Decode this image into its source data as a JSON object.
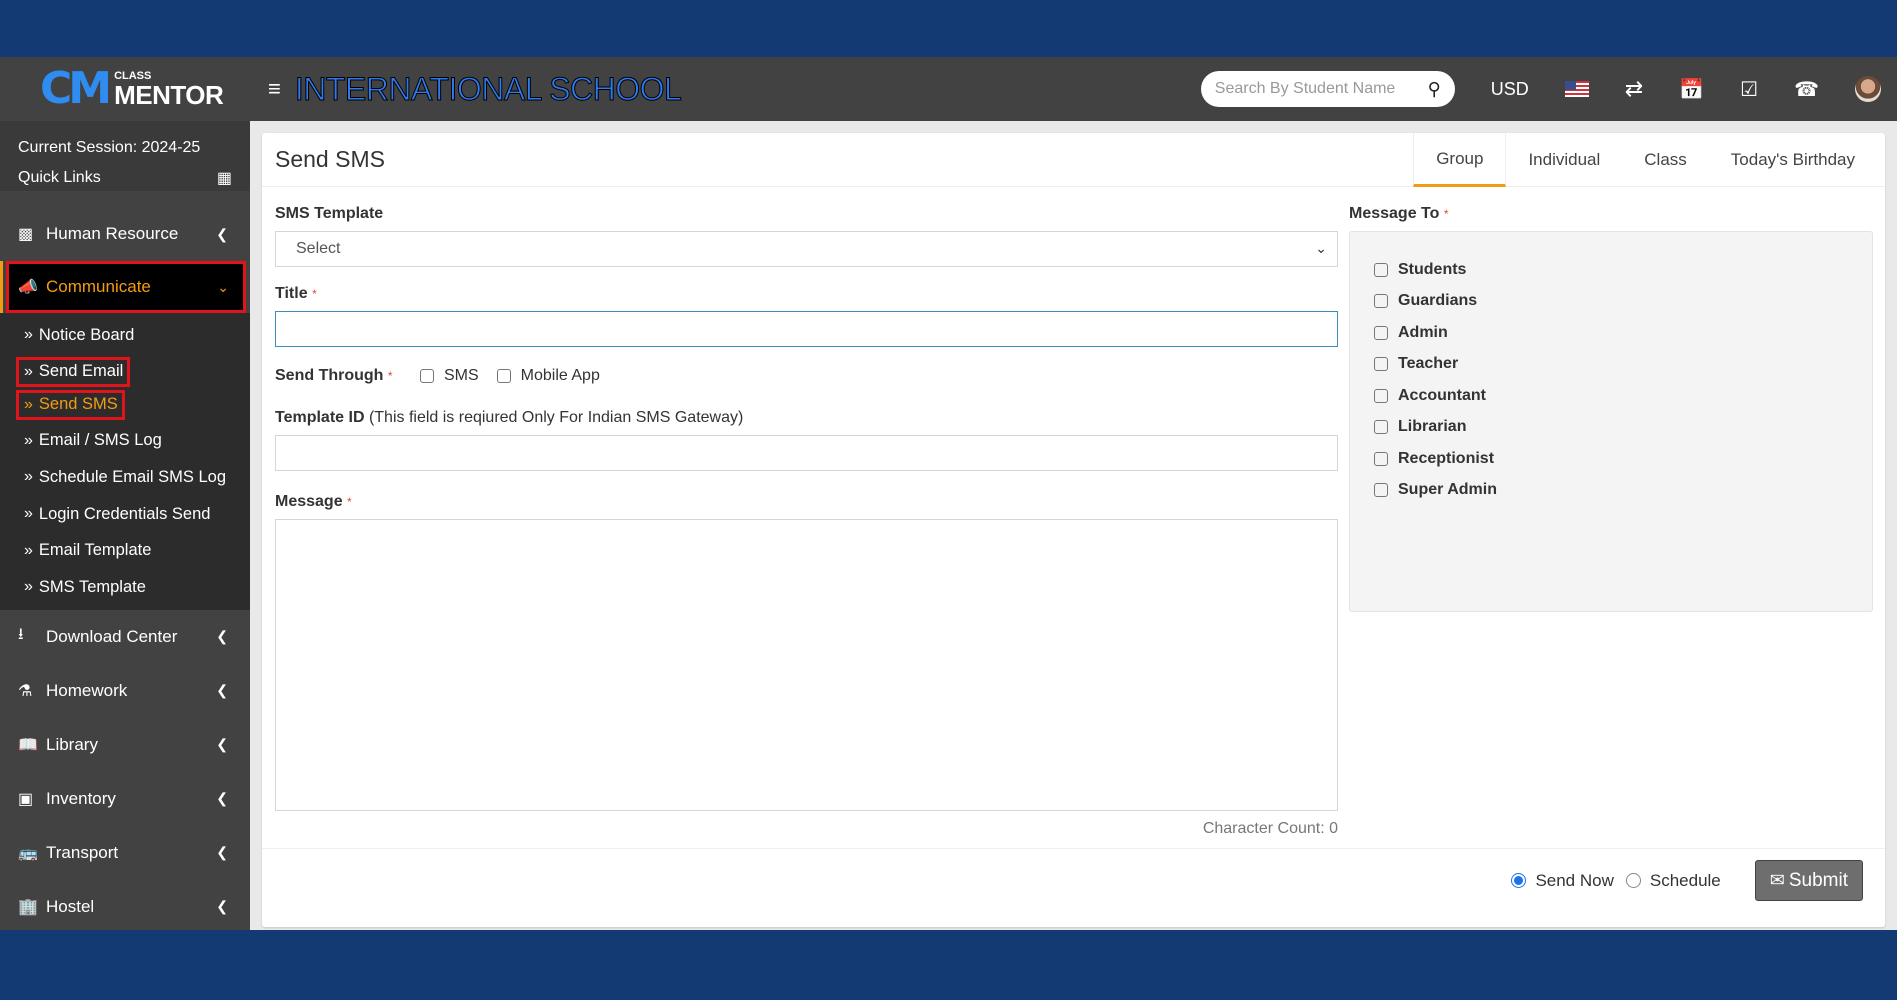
{
  "header": {
    "logo_small": "CLASS",
    "logo_big": "MENTOR",
    "logo_mark": "CM",
    "school_name": "INTERNATIONAL SCHOOL",
    "search_placeholder": "Search By Student Name",
    "currency": "USD",
    "icons": [
      "menu-icon",
      "search-icon",
      "us-flag-icon",
      "exchange-icon",
      "calendar-icon",
      "check-square-icon",
      "whatsapp-icon",
      "user-avatar"
    ]
  },
  "sidebar": {
    "session": "Current Session: 2024-25",
    "quick_links": "Quick Links",
    "menu_before": [
      {
        "label": "Human Resource",
        "icon": "sitemap-icon"
      }
    ],
    "active": {
      "label": "Communicate",
      "icon": "bullhorn-icon"
    },
    "submenu": [
      {
        "label": "Notice Board"
      },
      {
        "label": "Send Email"
      },
      {
        "label": "Send SMS"
      },
      {
        "label": "Email / SMS Log"
      },
      {
        "label": "Schedule Email SMS Log"
      },
      {
        "label": "Login Credentials Send"
      },
      {
        "label": "Email Template"
      },
      {
        "label": "SMS Template"
      }
    ],
    "menu_after": [
      {
        "label": "Download Center",
        "icon": "download-icon"
      },
      {
        "label": "Homework",
        "icon": "flask-icon"
      },
      {
        "label": "Library",
        "icon": "book-icon"
      },
      {
        "label": "Inventory",
        "icon": "object-group-icon"
      },
      {
        "label": "Transport",
        "icon": "bus-icon"
      },
      {
        "label": "Hostel",
        "icon": "building-icon"
      }
    ]
  },
  "card": {
    "title": "Send SMS",
    "tabs": [
      "Group",
      "Individual",
      "Class",
      "Today's Birthday"
    ],
    "active_tab": "Group",
    "sms_template_label": "SMS Template",
    "sms_template_value": "Select",
    "title_label": "Title",
    "title_value": "",
    "send_through_label": "Send Through",
    "send_through_options": [
      {
        "label": "SMS",
        "checked": false
      },
      {
        "label": "Mobile App",
        "checked": false
      }
    ],
    "template_id_label": "Template ID",
    "template_id_hint": "(This field is reqiured Only For Indian SMS Gateway)",
    "template_id_value": "",
    "message_label": "Message",
    "message_value": "",
    "character_count": "Character Count: 0",
    "message_to_label": "Message To",
    "recipients": [
      {
        "label": "Students",
        "checked": false
      },
      {
        "label": "Guardians",
        "checked": false
      },
      {
        "label": "Admin",
        "checked": false
      },
      {
        "label": "Teacher",
        "checked": false
      },
      {
        "label": "Accountant",
        "checked": false
      },
      {
        "label": "Librarian",
        "checked": false
      },
      {
        "label": "Receptionist",
        "checked": false
      },
      {
        "label": "Super Admin",
        "checked": false
      }
    ],
    "send_options": [
      {
        "label": "Send Now",
        "selected": true
      },
      {
        "label": "Schedule",
        "selected": false
      }
    ],
    "submit_label": "Submit",
    "required_mark": "*"
  },
  "colors": {
    "brand_blue": "#133a72",
    "accent_orange": "#f39c12",
    "highlight_red": "#e0151c",
    "header_gray": "#424242"
  }
}
